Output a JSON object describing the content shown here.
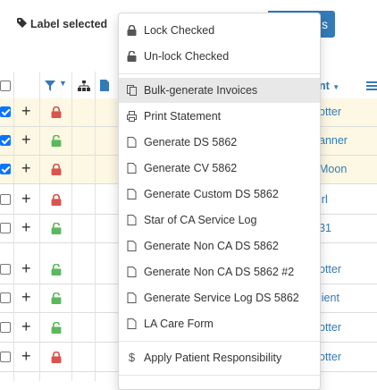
{
  "toolbar": {
    "label_selected": "Label selected",
    "blue_button_text": "s"
  },
  "table": {
    "header": {
      "account_label": "nt"
    },
    "rows": [
      {
        "checked": true,
        "locked": true,
        "name": "otter",
        "highlight": true
      },
      {
        "checked": true,
        "locked": false,
        "name": "anner",
        "highlight": true
      },
      {
        "checked": true,
        "locked": true,
        "name": "Moon",
        "highlight": true
      },
      {
        "checked": false,
        "locked": true,
        "name": "irl",
        "highlight": false
      },
      {
        "checked": false,
        "locked": false,
        "name": "31",
        "highlight": false
      },
      {
        "checked": false,
        "locked": false,
        "name": "otter",
        "highlight": false
      },
      {
        "checked": false,
        "locked": false,
        "name": "lient",
        "highlight": false
      },
      {
        "checked": false,
        "locked": false,
        "name": "otter",
        "highlight": false
      },
      {
        "checked": false,
        "locked": true,
        "name": "otter",
        "highlight": false
      }
    ]
  },
  "menu": {
    "lock_checked": "Lock Checked",
    "unlock_checked": "Un-lock Checked",
    "bulk_invoices": "Bulk-generate Invoices",
    "print_statement": "Print Statement",
    "gen_ds_5862": "Generate DS 5862",
    "gen_cv_5862": "Generate CV 5862",
    "gen_custom_ds": "Generate Custom DS 5862",
    "star_ca_log": "Star of CA Service Log",
    "gen_non_ca": "Generate Non CA DS 5862",
    "gen_non_ca_2": "Generate Non CA DS 5862 #2",
    "gen_service_log": "Generate Service Log DS 5862",
    "la_care": "LA Care Form",
    "apply_patient": "Apply Patient Responsibility"
  },
  "colors": {
    "primary": "#337ab7",
    "lock_red": "#d9534f",
    "unlock_green": "#5cb85c",
    "highlight": "#fcf8e3",
    "checkbox_blue": "#0a74ff"
  }
}
